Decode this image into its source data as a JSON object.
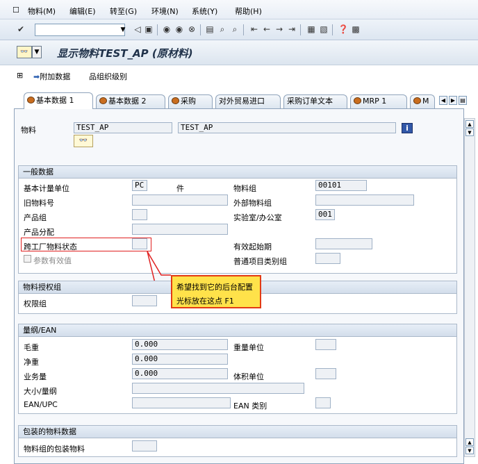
{
  "menu": {
    "items": [
      "物料(M)",
      "编辑(E)",
      "转至(G)",
      "环境(N)",
      "系统(Y)",
      "帮助(H)"
    ]
  },
  "toolbar": {
    "command_value": "",
    "icons": [
      "check-icon",
      "back-icon",
      "save-icon",
      "nav-back-icon",
      "exit-icon",
      "cancel-icon",
      "print-icon",
      "find-icon",
      "find-next-icon",
      "first-page-icon",
      "prev-page-icon",
      "next-page-icon",
      "last-page-icon",
      "new-session-icon",
      "shortcut-icon",
      "help-icon",
      "layout-icon"
    ]
  },
  "title": {
    "text": "显示物料TEST_AP (原材料)"
  },
  "app_toolbar": {
    "additional_data": "附加数据",
    "org_levels": "组织级别"
  },
  "tabs": [
    {
      "label": "基本数据 1",
      "active": true
    },
    {
      "label": "基本数据 2",
      "active": false
    },
    {
      "label": "采购",
      "active": false
    },
    {
      "label": "对外贸易进口",
      "active": false
    },
    {
      "label": "采购订单文本",
      "active": false
    },
    {
      "label": "MRP 1",
      "active": false
    },
    {
      "label": "M",
      "active": false
    }
  ],
  "header": {
    "material_label": "物料",
    "material_value": "TEST_AP",
    "material_desc": "TEST_AP",
    "info_glyph": "i"
  },
  "general": {
    "title": "一般数据",
    "base_unit_label": "基本计量单位",
    "base_unit_value": "PC",
    "base_unit_text": "件",
    "old_material_label": "旧物料号",
    "product_group_label": "产品组",
    "product_alloc_label": "产品分配",
    "xplant_status_label": "跨工厂物料状态",
    "param_effective_label": "参数有效值",
    "material_group_label": "物料组",
    "material_group_value": "00101",
    "ext_material_group_label": "外部物料组",
    "lab_office_label": "实验室/办公室",
    "lab_office_value": "001",
    "valid_from_label": "有效起始期",
    "item_cat_group_label": "普通项目类别组"
  },
  "auth": {
    "title": "物料授权组",
    "auth_group_label": "权限组"
  },
  "dims": {
    "title": "量纲/EAN",
    "gross_weight_label": "毛重",
    "gross_weight_value": "0.000",
    "net_weight_label": "净重",
    "net_weight_value": "0.000",
    "volume_label": "业务量",
    "volume_value": "0.000",
    "size_label": "大小/量纲",
    "ean_label": "EAN/UPC",
    "weight_unit_label": "重量单位",
    "volume_unit_label": "体积单位",
    "ean_type_label": "EAN 类别"
  },
  "packaging": {
    "title": "包装的物料数据",
    "mat_group_pack_label": "物料组的包装物料"
  },
  "callout": {
    "line1": "希望找到它的后台配置",
    "line2": "光标放在这点 F1"
  },
  "colors": {
    "highlight": "#e02020",
    "callout_bg": "#ffe24a"
  }
}
